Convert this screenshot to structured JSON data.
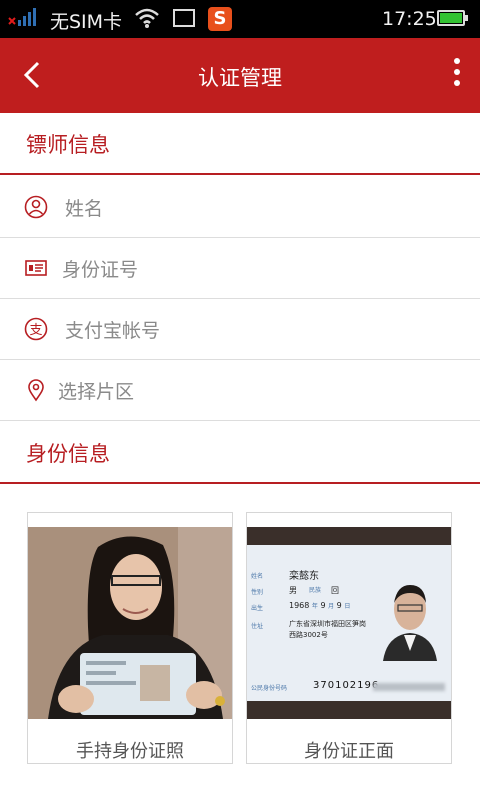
{
  "status_bar": {
    "carrier": "无SIM卡",
    "time": "17:25",
    "app_icon_letter": "S"
  },
  "header": {
    "title": "认证管理",
    "back_icon": "chevron-left-icon",
    "menu_icon": "more-vertical-icon"
  },
  "escort_info": {
    "title": "镖师信息",
    "fields": [
      {
        "placeholder": "姓名",
        "icon": "person-icon"
      },
      {
        "placeholder": "身份证号",
        "icon": "id-card-icon"
      },
      {
        "placeholder": "支付宝帐号",
        "icon": "alipay-icon"
      },
      {
        "placeholder": "选择片区",
        "icon": "location-pin-icon"
      }
    ]
  },
  "identity_info": {
    "title": "身份信息",
    "cards": [
      {
        "caption": "手持身份证照"
      },
      {
        "caption": "身份证正面"
      }
    ]
  },
  "id_card": {
    "labels": [
      "姓名",
      "性别",
      "民族",
      "出生",
      "住址",
      "公民身份号码"
    ],
    "name": "栾懿东",
    "sex": "男",
    "ethnicity": "回",
    "birth_year": "1968",
    "birth_month": "9",
    "birth_day": "9",
    "address_line1": "广东省深圳市福田区笋岗",
    "address_line2": "西路3002号",
    "id_number_visible": "370102196",
    "colors": {
      "accent": "#bf1e1e",
      "section_text": "#b71e22"
    }
  }
}
